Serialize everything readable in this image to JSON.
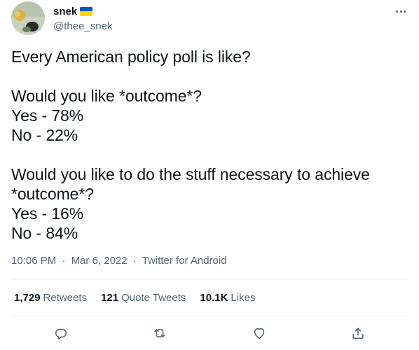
{
  "user": {
    "display_name": "snek",
    "handle": "@thee_snek",
    "flag_colors": {
      "top": "#0057b7",
      "bottom": "#ffd700"
    }
  },
  "tweet": {
    "lines": [
      "Every American policy poll is like?",
      "",
      "Would you like *outcome*?",
      "Yes - 78%",
      "No - 22%",
      "",
      "Would you like to do the stuff necessary to achieve",
      "*outcome*?",
      "Yes - 16%",
      "No - 84%"
    ],
    "time": "10:06 PM",
    "date": "Mar 6, 2022",
    "source": "Twitter for Android"
  },
  "stats": {
    "retweets_count": "1,729",
    "retweets_label": "Retweets",
    "quotes_count": "121",
    "quotes_label": "Quote Tweets",
    "likes_count": "10.1K",
    "likes_label": "Likes"
  },
  "icons": {
    "more": "more-icon",
    "reply": "reply-icon",
    "retweet": "retweet-icon",
    "like": "heart-icon",
    "share": "share-icon"
  },
  "colors": {
    "secondary_text": "#536471",
    "divider": "#eff3f4",
    "primary_text": "#0f1419"
  }
}
